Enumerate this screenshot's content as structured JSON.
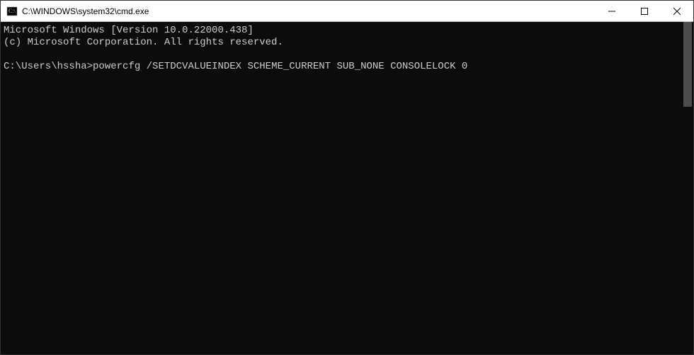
{
  "titlebar": {
    "title": "C:\\WINDOWS\\system32\\cmd.exe"
  },
  "terminal": {
    "line1": "Microsoft Windows [Version 10.0.22000.438]",
    "line2": "(c) Microsoft Corporation. All rights reserved.",
    "blank": "",
    "prompt": "C:\\Users\\hssha>",
    "command": "powercfg /SETDCVALUEINDEX SCHEME_CURRENT SUB_NONE CONSOLELOCK 0"
  }
}
